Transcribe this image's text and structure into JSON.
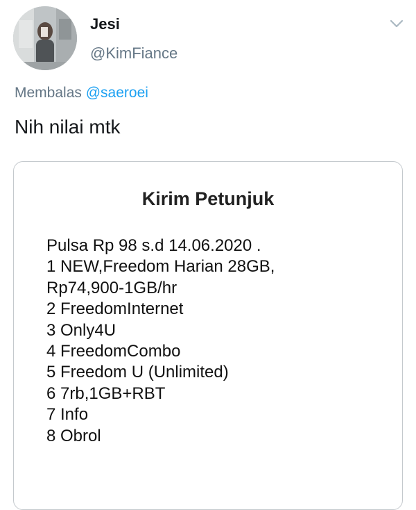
{
  "tweet": {
    "display_name": "Jesi",
    "handle": "@KimFiance",
    "reply_prefix": "Membalas",
    "reply_mention": "@saeroei",
    "text": "Nih nilai mtk"
  },
  "icons": {
    "avatar": "avatar-photo",
    "menu": "chevron-down-icon"
  },
  "colors": {
    "link": "#1da1f2",
    "secondary_text": "#657786",
    "primary_text": "#14171a"
  },
  "media": {
    "title": "Kirim Petunjuk",
    "lines": [
      "Pulsa Rp 98 s.d 14.06.2020 .",
      "1 NEW,Freedom Harian 28GB,",
      "Rp74,900-1GB/hr",
      "2 FreedomInternet",
      "3 Only4U",
      "4 FreedomCombo",
      "5 Freedom U (Unlimited)",
      "6 7rb,1GB+RBT",
      "7 Info",
      "8 Obrol"
    ]
  }
}
